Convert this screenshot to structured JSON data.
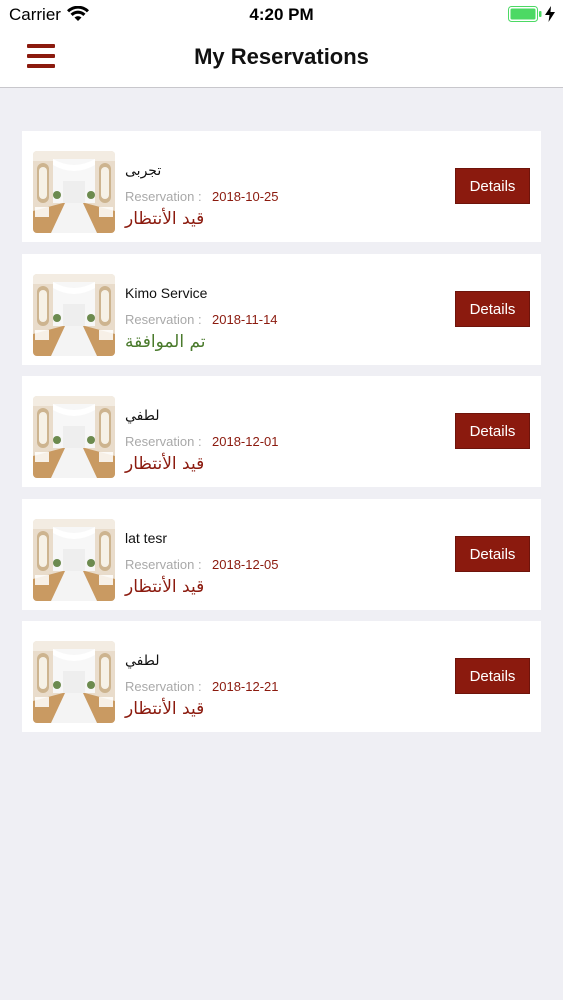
{
  "status_bar": {
    "carrier": "Carrier",
    "time": "4:20 PM"
  },
  "header": {
    "title": "My Reservations"
  },
  "colors": {
    "accent": "#8b1a0e",
    "approved": "#4a7a2c"
  },
  "reservations": [
    {
      "name": "تجربى",
      "label": "Reservation :",
      "date": "2018-10-25",
      "status": "قيد الأنتظار",
      "status_type": "pending",
      "button": "Details"
    },
    {
      "name": "Kimo Service",
      "label": "Reservation :",
      "date": "2018-11-14",
      "status": "تم الموافقة",
      "status_type": "approved",
      "button": "Details"
    },
    {
      "name": "لطفي",
      "label": "Reservation :",
      "date": "2018-12-01",
      "status": "قيد الأنتظار",
      "status_type": "pending",
      "button": "Details"
    },
    {
      "name": "lat tesr",
      "label": "Reservation :",
      "date": "2018-12-05",
      "status": "قيد الأنتظار",
      "status_type": "pending",
      "button": "Details"
    },
    {
      "name": "لطفي",
      "label": "Reservation :",
      "date": "2018-12-21",
      "status": "قيد الأنتظار",
      "status_type": "pending",
      "button": "Details"
    }
  ]
}
